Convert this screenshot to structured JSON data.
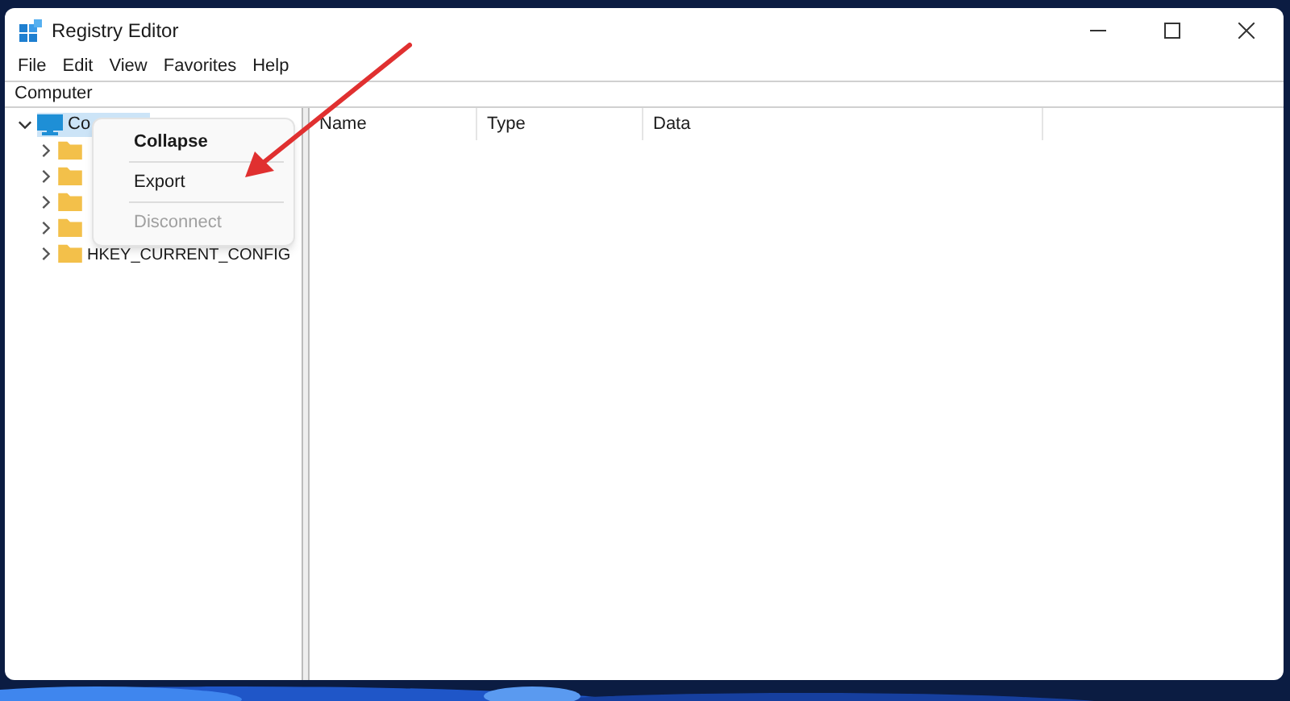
{
  "window": {
    "title": "Registry Editor"
  },
  "menu_bar": [
    "File",
    "Edit",
    "View",
    "Favorites",
    "Help"
  ],
  "address_bar": {
    "value": "Computer"
  },
  "tree": [
    {
      "label": "Co",
      "expanded": true,
      "selected": true,
      "children": [
        {
          "expanded": false
        },
        {
          "expanded": false
        },
        {
          "expanded": false
        },
        {
          "expanded": false
        },
        {
          "label": "HKEY_CURRENT_CONFIG",
          "expanded": false
        }
      ]
    }
  ],
  "table": {
    "columns": [
      "Name",
      "Type",
      "Data"
    ]
  },
  "context_menu": {
    "items": [
      {
        "label": "Collapse",
        "bold": true,
        "disabled": false
      },
      {
        "label": "Export",
        "bold": false,
        "disabled": false
      },
      {
        "label": "Disconnect",
        "bold": false,
        "disabled": true
      }
    ]
  }
}
